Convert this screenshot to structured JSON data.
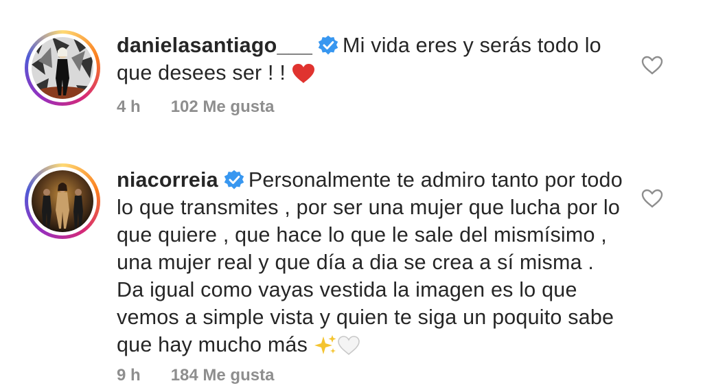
{
  "comments": [
    {
      "username": "danielasantiago___",
      "text": "Mi vida eres y serás todo lo que desees ser ! !",
      "emoji": "❤️",
      "time": "4 h",
      "likes": "102 Me gusta"
    },
    {
      "username": "niacorreia",
      "text": "Personalmente te admiro tanto por todo lo que transmites , por ser una mujer que lucha por lo que quiere , que hace lo que le sale del mismísimo , una mujer real y que día a dia se crea a sí misma . Da igual como vayas vestida la imagen es lo que vemos a simple vista y quien te siga un poquito sabe que hay mucho más",
      "emoji": "✨🤍",
      "time": "9 h",
      "likes": "184 Me gusta"
    }
  ],
  "colors": {
    "verified": "#3897f0",
    "meta": "#8e8e8e",
    "heart": "#8e8e8e"
  }
}
